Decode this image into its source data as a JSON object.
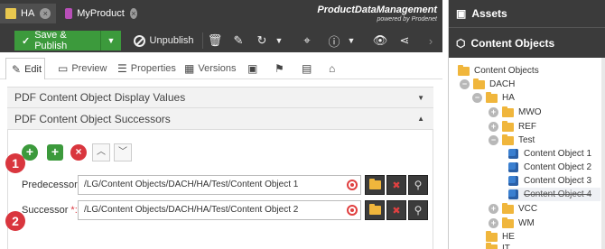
{
  "header": {
    "tabs": [
      {
        "label": "HA",
        "active": true
      },
      {
        "label": "MyProduct",
        "active": false
      }
    ],
    "brand_title": "ProductDataManagement",
    "brand_sub": "powered by Prodenet"
  },
  "toolbar": {
    "save_publish": "Save & Publish",
    "unpublish": "Unpublish"
  },
  "subtabs": [
    "Edit",
    "Preview",
    "Properties",
    "Versions"
  ],
  "panels": {
    "display_values": "PDF Content Object Display Values",
    "successors": "PDF Content Object Successors"
  },
  "markers": [
    "1",
    "2"
  ],
  "fields": {
    "predecessor": {
      "label": "Predecessor",
      "req": "*:",
      "value": "/LG/Content Objects/DACH/HA/Test/Content Object 1"
    },
    "successor": {
      "label": "Successor",
      "req": "*:",
      "value": "/LG/Content Objects/DACH/HA/Test/Content Object 2"
    }
  },
  "assets": {
    "title": "Assets",
    "section": "Content Objects",
    "tree": [
      {
        "label": "Content Objects",
        "type": "folder",
        "toggle": ""
      },
      {
        "label": "DACH",
        "type": "folder",
        "toggle": "−"
      },
      {
        "label": "HA",
        "type": "folder",
        "toggle": "−"
      },
      {
        "label": "MWO",
        "type": "folder",
        "toggle": "+"
      },
      {
        "label": "REF",
        "type": "folder",
        "toggle": "+"
      },
      {
        "label": "Test",
        "type": "folder",
        "toggle": "−"
      },
      {
        "label": "Content Object 1",
        "type": "object",
        "toggle": ""
      },
      {
        "label": "Content Object 2",
        "type": "object",
        "toggle": ""
      },
      {
        "label": "Content Object 3",
        "type": "object",
        "toggle": ""
      },
      {
        "label": "Content Object 4",
        "type": "object",
        "toggle": "",
        "strike": true
      },
      {
        "label": "VCC",
        "type": "folder",
        "toggle": "+"
      },
      {
        "label": "WM",
        "type": "folder",
        "toggle": "+"
      },
      {
        "label": "HE",
        "type": "folder",
        "toggle": ""
      },
      {
        "label": "IT",
        "type": "folder",
        "toggle": ""
      }
    ]
  },
  "colors": {
    "dark": "#3b3b3b",
    "green": "#3c9a3c",
    "red": "#d9363e",
    "folder": "#f0b63c",
    "object": "#3a7fd0"
  }
}
